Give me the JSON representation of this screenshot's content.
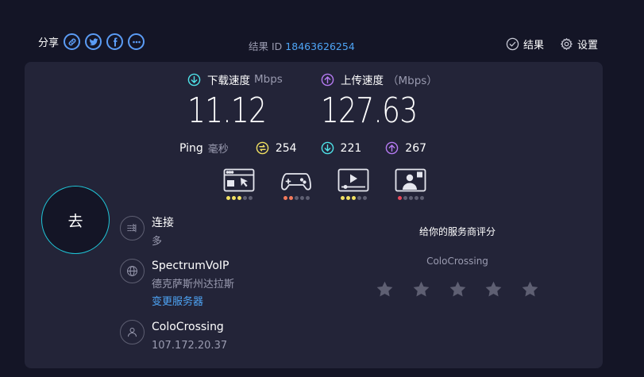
{
  "share": {
    "label": "分享"
  },
  "result": {
    "label": "结果 ID",
    "id": "18463626254"
  },
  "top_right": {
    "results_label": "结果",
    "settings_label": "设置"
  },
  "download": {
    "label": "下载速度",
    "unit": "Mbps",
    "value": "11.12",
    "color": "#4ee2e8"
  },
  "upload": {
    "label": "上传速度",
    "unit": "（Mbps）",
    "value": "127.63",
    "color": "#b57af2"
  },
  "ping": {
    "label": "Ping",
    "unit": "毫秒",
    "idle": "254",
    "download": "221",
    "upload": "267",
    "idle_color": "#f1e062"
  },
  "categories": [
    {
      "icon": "web-browsing-icon",
      "dots": [
        "#f1e062",
        "#f1e062",
        "#f1e062",
        "#5e5f72",
        "#5e5f72"
      ]
    },
    {
      "icon": "gaming-icon",
      "dots": [
        "#f47a5c",
        "#f47a5c",
        "#5e5f72",
        "#5e5f72",
        "#5e5f72"
      ]
    },
    {
      "icon": "video-streaming-icon",
      "dots": [
        "#f1e062",
        "#f1e062",
        "#f1e062",
        "#5e5f72",
        "#5e5f72"
      ]
    },
    {
      "icon": "video-chat-icon",
      "dots": [
        "#e8485a",
        "#5e5f72",
        "#5e5f72",
        "#5e5f72",
        "#5e5f72"
      ]
    }
  ],
  "go_button": {
    "label": "去"
  },
  "connection": {
    "title": "连接",
    "value": "多"
  },
  "server": {
    "name": "SpectrumVoIP",
    "location": "德克萨斯州达拉斯",
    "change_label": "变更服务器"
  },
  "provider": {
    "name": "ColoCrossing",
    "ip": "107.172.20.37"
  },
  "rating": {
    "title": "给你的服务商评分",
    "isp": "ColoCrossing",
    "star_count": 5,
    "star_color": "#5e5f72"
  }
}
